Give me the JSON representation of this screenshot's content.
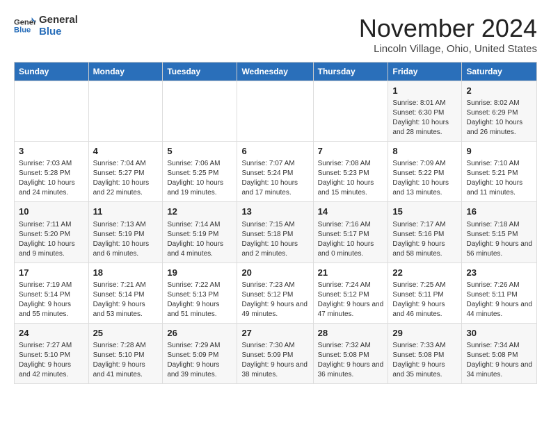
{
  "header": {
    "logo_general": "General",
    "logo_blue": "Blue",
    "month_title": "November 2024",
    "location": "Lincoln Village, Ohio, United States"
  },
  "weekdays": [
    "Sunday",
    "Monday",
    "Tuesday",
    "Wednesday",
    "Thursday",
    "Friday",
    "Saturday"
  ],
  "weeks": [
    [
      {
        "day": "",
        "info": ""
      },
      {
        "day": "",
        "info": ""
      },
      {
        "day": "",
        "info": ""
      },
      {
        "day": "",
        "info": ""
      },
      {
        "day": "",
        "info": ""
      },
      {
        "day": "1",
        "info": "Sunrise: 8:01 AM\nSunset: 6:30 PM\nDaylight: 10 hours and 28 minutes."
      },
      {
        "day": "2",
        "info": "Sunrise: 8:02 AM\nSunset: 6:29 PM\nDaylight: 10 hours and 26 minutes."
      }
    ],
    [
      {
        "day": "3",
        "info": "Sunrise: 7:03 AM\nSunset: 5:28 PM\nDaylight: 10 hours and 24 minutes."
      },
      {
        "day": "4",
        "info": "Sunrise: 7:04 AM\nSunset: 5:27 PM\nDaylight: 10 hours and 22 minutes."
      },
      {
        "day": "5",
        "info": "Sunrise: 7:06 AM\nSunset: 5:25 PM\nDaylight: 10 hours and 19 minutes."
      },
      {
        "day": "6",
        "info": "Sunrise: 7:07 AM\nSunset: 5:24 PM\nDaylight: 10 hours and 17 minutes."
      },
      {
        "day": "7",
        "info": "Sunrise: 7:08 AM\nSunset: 5:23 PM\nDaylight: 10 hours and 15 minutes."
      },
      {
        "day": "8",
        "info": "Sunrise: 7:09 AM\nSunset: 5:22 PM\nDaylight: 10 hours and 13 minutes."
      },
      {
        "day": "9",
        "info": "Sunrise: 7:10 AM\nSunset: 5:21 PM\nDaylight: 10 hours and 11 minutes."
      }
    ],
    [
      {
        "day": "10",
        "info": "Sunrise: 7:11 AM\nSunset: 5:20 PM\nDaylight: 10 hours and 9 minutes."
      },
      {
        "day": "11",
        "info": "Sunrise: 7:13 AM\nSunset: 5:19 PM\nDaylight: 10 hours and 6 minutes."
      },
      {
        "day": "12",
        "info": "Sunrise: 7:14 AM\nSunset: 5:19 PM\nDaylight: 10 hours and 4 minutes."
      },
      {
        "day": "13",
        "info": "Sunrise: 7:15 AM\nSunset: 5:18 PM\nDaylight: 10 hours and 2 minutes."
      },
      {
        "day": "14",
        "info": "Sunrise: 7:16 AM\nSunset: 5:17 PM\nDaylight: 10 hours and 0 minutes."
      },
      {
        "day": "15",
        "info": "Sunrise: 7:17 AM\nSunset: 5:16 PM\nDaylight: 9 hours and 58 minutes."
      },
      {
        "day": "16",
        "info": "Sunrise: 7:18 AM\nSunset: 5:15 PM\nDaylight: 9 hours and 56 minutes."
      }
    ],
    [
      {
        "day": "17",
        "info": "Sunrise: 7:19 AM\nSunset: 5:14 PM\nDaylight: 9 hours and 55 minutes."
      },
      {
        "day": "18",
        "info": "Sunrise: 7:21 AM\nSunset: 5:14 PM\nDaylight: 9 hours and 53 minutes."
      },
      {
        "day": "19",
        "info": "Sunrise: 7:22 AM\nSunset: 5:13 PM\nDaylight: 9 hours and 51 minutes."
      },
      {
        "day": "20",
        "info": "Sunrise: 7:23 AM\nSunset: 5:12 PM\nDaylight: 9 hours and 49 minutes."
      },
      {
        "day": "21",
        "info": "Sunrise: 7:24 AM\nSunset: 5:12 PM\nDaylight: 9 hours and 47 minutes."
      },
      {
        "day": "22",
        "info": "Sunrise: 7:25 AM\nSunset: 5:11 PM\nDaylight: 9 hours and 46 minutes."
      },
      {
        "day": "23",
        "info": "Sunrise: 7:26 AM\nSunset: 5:11 PM\nDaylight: 9 hours and 44 minutes."
      }
    ],
    [
      {
        "day": "24",
        "info": "Sunrise: 7:27 AM\nSunset: 5:10 PM\nDaylight: 9 hours and 42 minutes."
      },
      {
        "day": "25",
        "info": "Sunrise: 7:28 AM\nSunset: 5:10 PM\nDaylight: 9 hours and 41 minutes."
      },
      {
        "day": "26",
        "info": "Sunrise: 7:29 AM\nSunset: 5:09 PM\nDaylight: 9 hours and 39 minutes."
      },
      {
        "day": "27",
        "info": "Sunrise: 7:30 AM\nSunset: 5:09 PM\nDaylight: 9 hours and 38 minutes."
      },
      {
        "day": "28",
        "info": "Sunrise: 7:32 AM\nSunset: 5:08 PM\nDaylight: 9 hours and 36 minutes."
      },
      {
        "day": "29",
        "info": "Sunrise: 7:33 AM\nSunset: 5:08 PM\nDaylight: 9 hours and 35 minutes."
      },
      {
        "day": "30",
        "info": "Sunrise: 7:34 AM\nSunset: 5:08 PM\nDaylight: 9 hours and 34 minutes."
      }
    ]
  ]
}
